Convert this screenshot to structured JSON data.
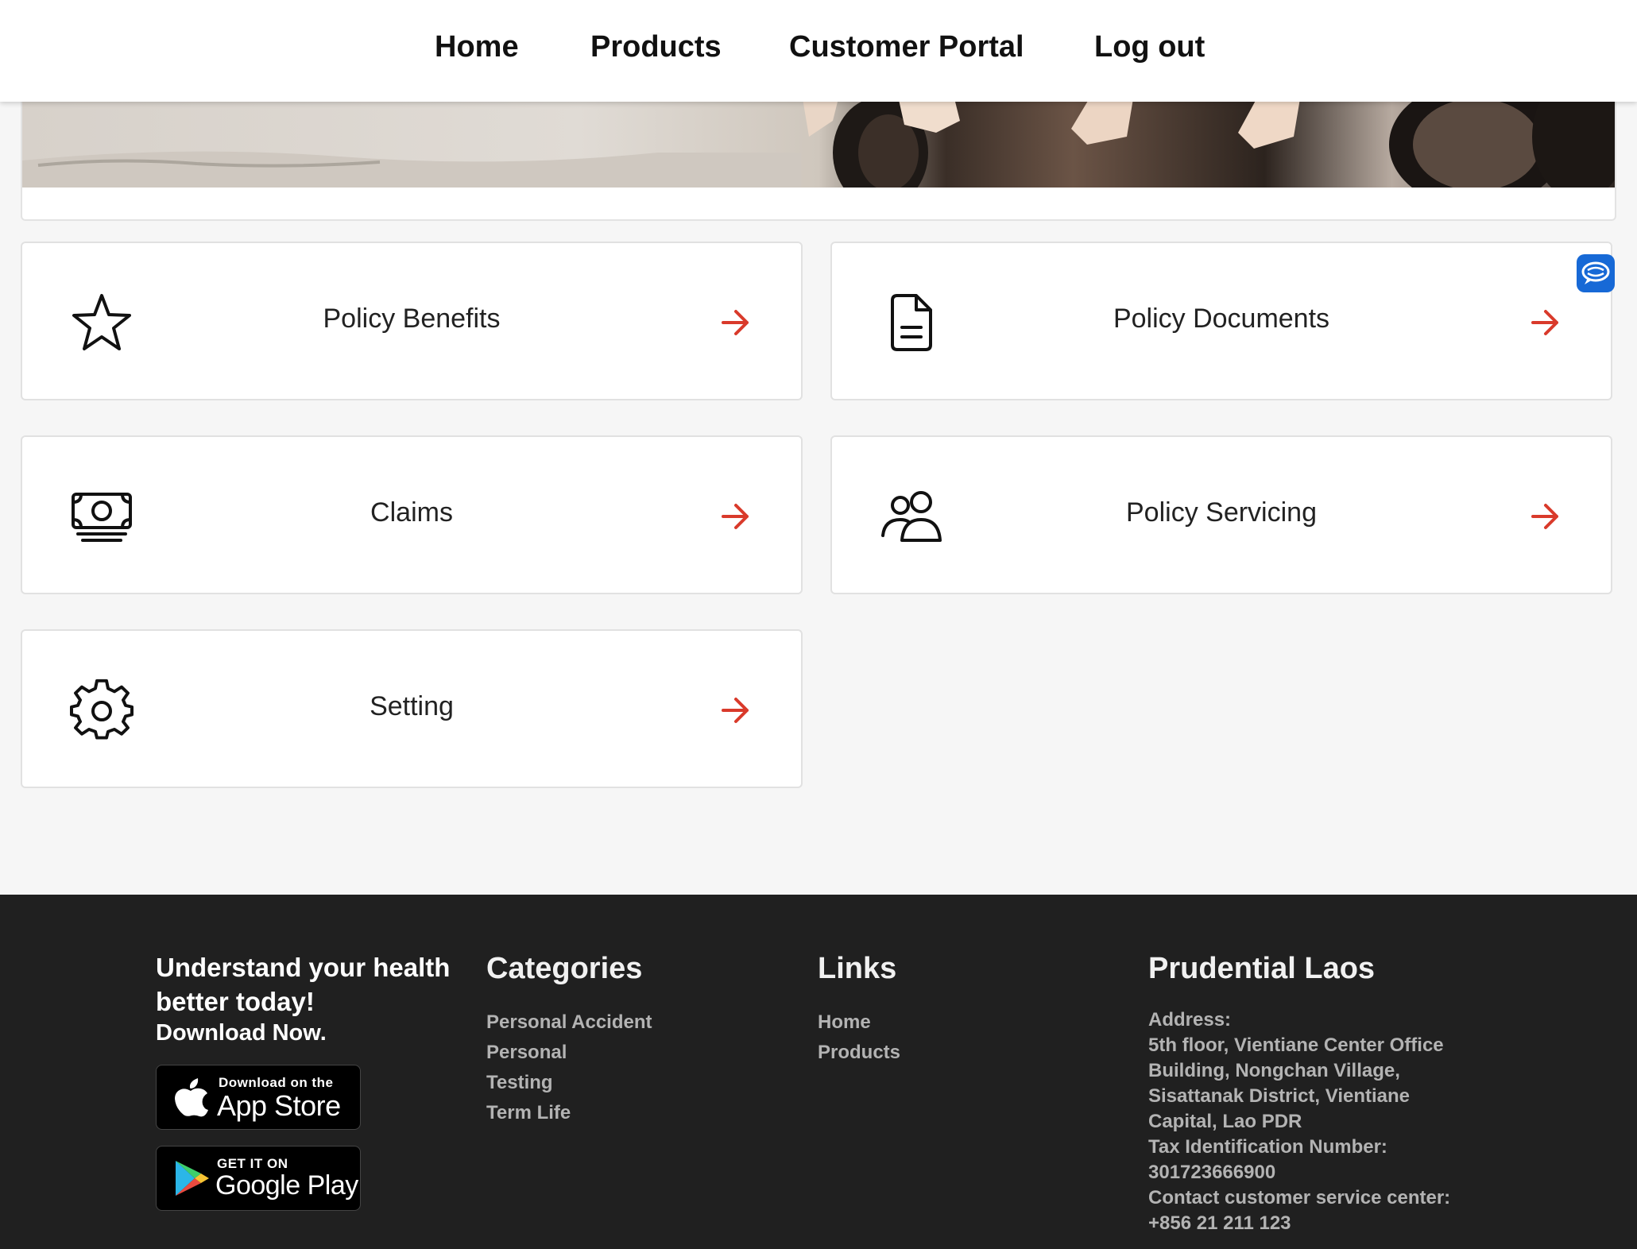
{
  "nav": {
    "items": [
      "Home",
      "Products",
      "Customer Portal",
      "Log out"
    ]
  },
  "tiles": [
    {
      "label": "Policy Benefits",
      "icon": "star-icon"
    },
    {
      "label": "Policy Documents",
      "icon": "document-icon"
    },
    {
      "label": "Claims",
      "icon": "cash-icon"
    },
    {
      "label": "Policy Servicing",
      "icon": "users-icon"
    },
    {
      "label": "Setting",
      "icon": "gear-icon"
    }
  ],
  "colors": {
    "accent_arrow": "#d93a2b",
    "footer_bg": "#202020",
    "chat_button": "#1769d6"
  },
  "footer": {
    "promo_title": "Understand your health better today!",
    "promo_cta": "Download Now.",
    "app_store": {
      "small": "Download on the",
      "big": "App Store"
    },
    "google_play": {
      "small": "GET IT ON",
      "big": "Google Play"
    },
    "categories": {
      "heading": "Categories",
      "items": [
        "Personal Accident",
        "Personal",
        "Testing",
        "Term Life"
      ]
    },
    "links": {
      "heading": "Links",
      "items": [
        "Home",
        "Products"
      ]
    },
    "company": {
      "heading": "Prudential Laos",
      "address_label": "Address:",
      "address": "5th floor, Vientiane Center Office Building, Nongchan Village, Sisattanak District, Vientiane Capital, Lao PDR",
      "tax_label": "Tax Identification Number:",
      "tax_number": "301723666900",
      "contact_label": "Contact customer service center:",
      "contact_phone": "+856 21 211 123"
    }
  }
}
